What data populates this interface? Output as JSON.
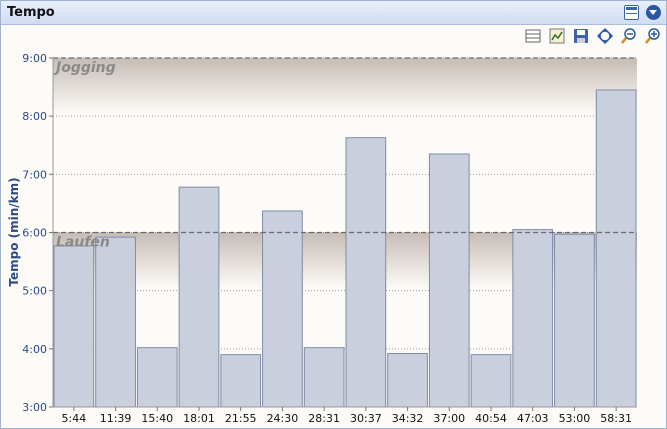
{
  "panel": {
    "title": "Tempo"
  },
  "icons": {
    "restore": "window-restore-icon",
    "collapse": "collapse-circle-icon",
    "tools": [
      "table-view-icon",
      "chart-edit-icon",
      "save-icon",
      "zoom-fit-icon",
      "zoom-out-icon",
      "zoom-in-icon"
    ]
  },
  "colors": {
    "bar_fill": "#c9cfdc",
    "bar_stroke": "#7f8ba8",
    "band": "#b4a7a0",
    "plot_bg": "#fdfbf7",
    "axis_text": "#2a4a8a"
  },
  "chart_data": {
    "type": "bar",
    "title": "",
    "xlabel": "",
    "ylabel": "Tempo (min/km)",
    "categories": [
      "5:44",
      "11:39",
      "15:40",
      "18:01",
      "21:55",
      "24:30",
      "28:31",
      "30:37",
      "34:32",
      "37:00",
      "40:54",
      "47:03",
      "53:00",
      "58:31"
    ],
    "values_min_per_km": [
      5.77,
      5.92,
      4.02,
      6.78,
      3.9,
      6.37,
      4.02,
      7.63,
      3.92,
      7.35,
      3.9,
      6.05,
      5.97,
      8.45
    ],
    "y_ticks": [
      "3:00",
      "4:00",
      "5:00",
      "6:00",
      "7:00",
      "8:00",
      "9:00"
    ],
    "ylim": [
      3,
      9
    ],
    "grid": "horizontal-dotted",
    "reference_lines": [
      {
        "label": "Jogging",
        "value": 9
      },
      {
        "label": "Laufen",
        "value": 6
      }
    ]
  }
}
